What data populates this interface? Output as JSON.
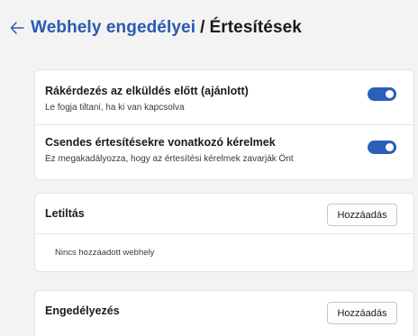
{
  "header": {
    "breadcrumb_parent": "Webhely engedélyei",
    "separator": "/",
    "current": "Értesítések",
    "back_icon": "arrow-left-icon"
  },
  "toggles": [
    {
      "title": "Rákérdezés az elküldés előtt (ajánlott)",
      "description": "Le fogja tiltani, ha ki van kapcsolva",
      "enabled": true
    },
    {
      "title": "Csendes értesítésekre vonatkozó kérelmek",
      "description": "Ez megakadályozza, hogy az értesítési kérelmek zavarják Önt",
      "enabled": true
    }
  ],
  "block": {
    "title": "Letiltás",
    "add_label": "Hozzáadás",
    "empty_text": "Nincs hozzáadott webhely"
  },
  "allow": {
    "title": "Engedélyezés",
    "add_label": "Hozzáadás"
  },
  "colors": {
    "accent": "#2b5fb8",
    "link": "#2a5ab0",
    "background": "#f3f3f3"
  }
}
